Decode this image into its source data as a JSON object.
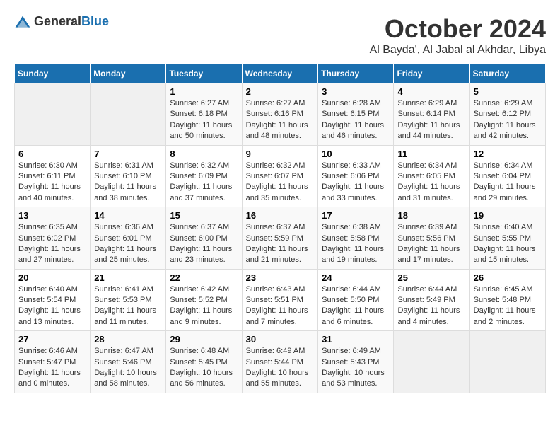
{
  "logo": {
    "text_general": "General",
    "text_blue": "Blue"
  },
  "title": "October 2024",
  "location": "Al Bayda', Al Jabal al Akhdar, Libya",
  "headers": [
    "Sunday",
    "Monday",
    "Tuesday",
    "Wednesday",
    "Thursday",
    "Friday",
    "Saturday"
  ],
  "weeks": [
    [
      {
        "day": "",
        "info": ""
      },
      {
        "day": "",
        "info": ""
      },
      {
        "day": "1",
        "sunrise": "6:27 AM",
        "sunset": "6:18 PM",
        "daylight": "11 hours and 50 minutes."
      },
      {
        "day": "2",
        "sunrise": "6:27 AM",
        "sunset": "6:16 PM",
        "daylight": "11 hours and 48 minutes."
      },
      {
        "day": "3",
        "sunrise": "6:28 AM",
        "sunset": "6:15 PM",
        "daylight": "11 hours and 46 minutes."
      },
      {
        "day": "4",
        "sunrise": "6:29 AM",
        "sunset": "6:14 PM",
        "daylight": "11 hours and 44 minutes."
      },
      {
        "day": "5",
        "sunrise": "6:29 AM",
        "sunset": "6:12 PM",
        "daylight": "11 hours and 42 minutes."
      }
    ],
    [
      {
        "day": "6",
        "sunrise": "6:30 AM",
        "sunset": "6:11 PM",
        "daylight": "11 hours and 40 minutes."
      },
      {
        "day": "7",
        "sunrise": "6:31 AM",
        "sunset": "6:10 PM",
        "daylight": "11 hours and 38 minutes."
      },
      {
        "day": "8",
        "sunrise": "6:32 AM",
        "sunset": "6:09 PM",
        "daylight": "11 hours and 37 minutes."
      },
      {
        "day": "9",
        "sunrise": "6:32 AM",
        "sunset": "6:07 PM",
        "daylight": "11 hours and 35 minutes."
      },
      {
        "day": "10",
        "sunrise": "6:33 AM",
        "sunset": "6:06 PM",
        "daylight": "11 hours and 33 minutes."
      },
      {
        "day": "11",
        "sunrise": "6:34 AM",
        "sunset": "6:05 PM",
        "daylight": "11 hours and 31 minutes."
      },
      {
        "day": "12",
        "sunrise": "6:34 AM",
        "sunset": "6:04 PM",
        "daylight": "11 hours and 29 minutes."
      }
    ],
    [
      {
        "day": "13",
        "sunrise": "6:35 AM",
        "sunset": "6:02 PM",
        "daylight": "11 hours and 27 minutes."
      },
      {
        "day": "14",
        "sunrise": "6:36 AM",
        "sunset": "6:01 PM",
        "daylight": "11 hours and 25 minutes."
      },
      {
        "day": "15",
        "sunrise": "6:37 AM",
        "sunset": "6:00 PM",
        "daylight": "11 hours and 23 minutes."
      },
      {
        "day": "16",
        "sunrise": "6:37 AM",
        "sunset": "5:59 PM",
        "daylight": "11 hours and 21 minutes."
      },
      {
        "day": "17",
        "sunrise": "6:38 AM",
        "sunset": "5:58 PM",
        "daylight": "11 hours and 19 minutes."
      },
      {
        "day": "18",
        "sunrise": "6:39 AM",
        "sunset": "5:56 PM",
        "daylight": "11 hours and 17 minutes."
      },
      {
        "day": "19",
        "sunrise": "6:40 AM",
        "sunset": "5:55 PM",
        "daylight": "11 hours and 15 minutes."
      }
    ],
    [
      {
        "day": "20",
        "sunrise": "6:40 AM",
        "sunset": "5:54 PM",
        "daylight": "11 hours and 13 minutes."
      },
      {
        "day": "21",
        "sunrise": "6:41 AM",
        "sunset": "5:53 PM",
        "daylight": "11 hours and 11 minutes."
      },
      {
        "day": "22",
        "sunrise": "6:42 AM",
        "sunset": "5:52 PM",
        "daylight": "11 hours and 9 minutes."
      },
      {
        "day": "23",
        "sunrise": "6:43 AM",
        "sunset": "5:51 PM",
        "daylight": "11 hours and 7 minutes."
      },
      {
        "day": "24",
        "sunrise": "6:44 AM",
        "sunset": "5:50 PM",
        "daylight": "11 hours and 6 minutes."
      },
      {
        "day": "25",
        "sunrise": "6:44 AM",
        "sunset": "5:49 PM",
        "daylight": "11 hours and 4 minutes."
      },
      {
        "day": "26",
        "sunrise": "6:45 AM",
        "sunset": "5:48 PM",
        "daylight": "11 hours and 2 minutes."
      }
    ],
    [
      {
        "day": "27",
        "sunrise": "6:46 AM",
        "sunset": "5:47 PM",
        "daylight": "11 hours and 0 minutes."
      },
      {
        "day": "28",
        "sunrise": "6:47 AM",
        "sunset": "5:46 PM",
        "daylight": "10 hours and 58 minutes."
      },
      {
        "day": "29",
        "sunrise": "6:48 AM",
        "sunset": "5:45 PM",
        "daylight": "10 hours and 56 minutes."
      },
      {
        "day": "30",
        "sunrise": "6:49 AM",
        "sunset": "5:44 PM",
        "daylight": "10 hours and 55 minutes."
      },
      {
        "day": "31",
        "sunrise": "6:49 AM",
        "sunset": "5:43 PM",
        "daylight": "10 hours and 53 minutes."
      },
      {
        "day": "",
        "info": ""
      },
      {
        "day": "",
        "info": ""
      }
    ]
  ],
  "labels": {
    "sunrise": "Sunrise:",
    "sunset": "Sunset:",
    "daylight": "Daylight:"
  }
}
